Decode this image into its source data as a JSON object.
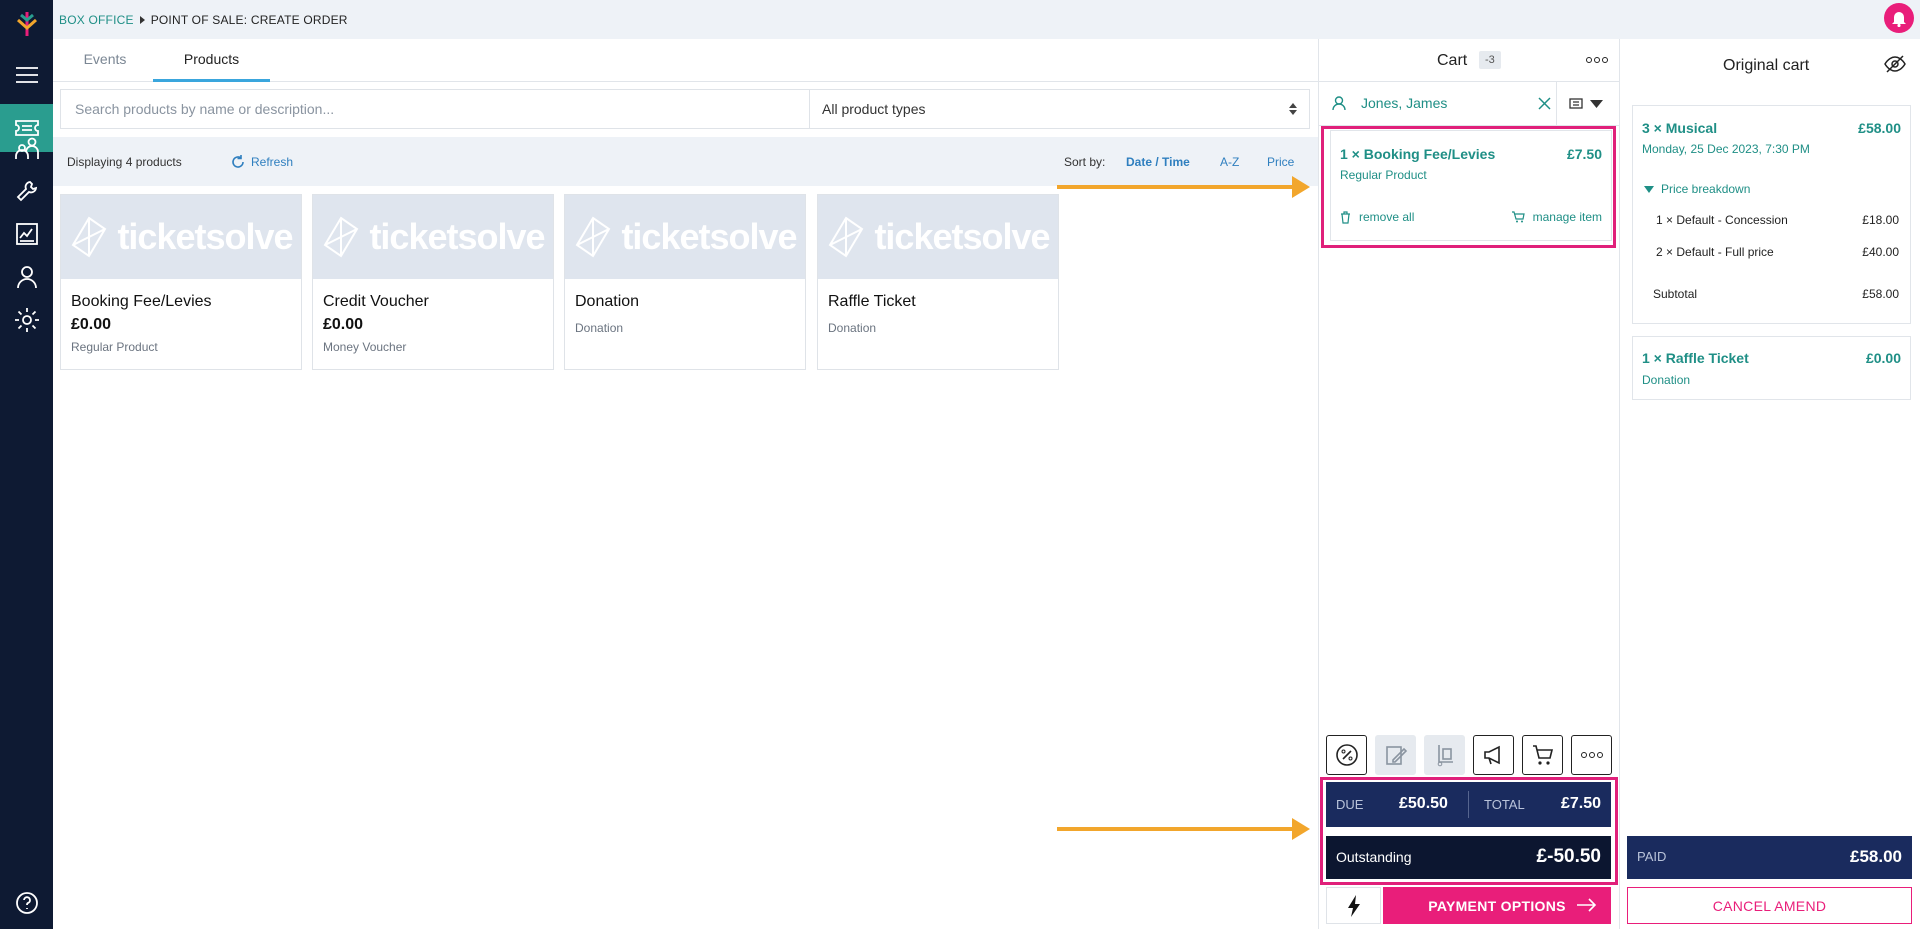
{
  "breadcrumb": {
    "section": "BOX OFFICE",
    "current": "POINT OF SALE: CREATE ORDER"
  },
  "tabs": [
    {
      "label": "Events"
    },
    {
      "label": "Products"
    }
  ],
  "search": {
    "placeholder": "Search products by name or description...",
    "type_filter": "All product types"
  },
  "listbar": {
    "count_text": "Displaying 4 products",
    "refresh_label": "Refresh",
    "sort_label": "Sort by:",
    "sort_options": [
      "Date / Time",
      "A-Z",
      "Price"
    ]
  },
  "brand_text": "ticketsolve",
  "products": [
    {
      "name": "Booking Fee/Levies",
      "price": "£0.00",
      "type": "Regular Product"
    },
    {
      "name": "Credit Voucher",
      "price": "£0.00",
      "type": "Money Voucher"
    },
    {
      "name": "Donation",
      "price": "",
      "type": "Donation"
    },
    {
      "name": "Raffle Ticket",
      "price": "",
      "type": "Donation"
    }
  ],
  "cart": {
    "title": "Cart",
    "badge": "-3",
    "customer": "Jones, James",
    "item": {
      "title": "1 × Booking Fee/Levies",
      "price": "£7.50",
      "type": "Regular Product",
      "remove_label": "remove all",
      "manage_label": "manage item"
    },
    "due_label": "DUE",
    "due_value": "£50.50",
    "total_label": "TOTAL",
    "total_value": "£7.50",
    "outstanding_label": "Outstanding",
    "outstanding_value": "£-50.50",
    "payment_label": "PAYMENT OPTIONS"
  },
  "original_cart": {
    "title": "Original cart",
    "item1": {
      "title": "3 × Musical",
      "price": "£58.00",
      "date": "Monday, 25 Dec 2023, 7:30 PM",
      "breakdown_label": "Price breakdown",
      "lines": [
        {
          "label": "1 × Default - Concession",
          "value": "£18.00"
        },
        {
          "label": "2 × Default - Full price",
          "value": "£40.00"
        }
      ],
      "subtotal_label": "Subtotal",
      "subtotal_value": "£58.00"
    },
    "item2": {
      "title": "1 × Raffle Ticket",
      "price": "£0.00",
      "type": "Donation"
    },
    "paid_label": "PAID",
    "paid_value": "£58.00",
    "cancel_label": "CANCEL AMEND"
  },
  "colors": {
    "nav": "#0e1a33",
    "accent_teal": "#1f8f86",
    "pink": "#e91e7a",
    "navy": "#1a2b5e",
    "highlight": "#e0207a",
    "arrow": "#f2a62c"
  }
}
